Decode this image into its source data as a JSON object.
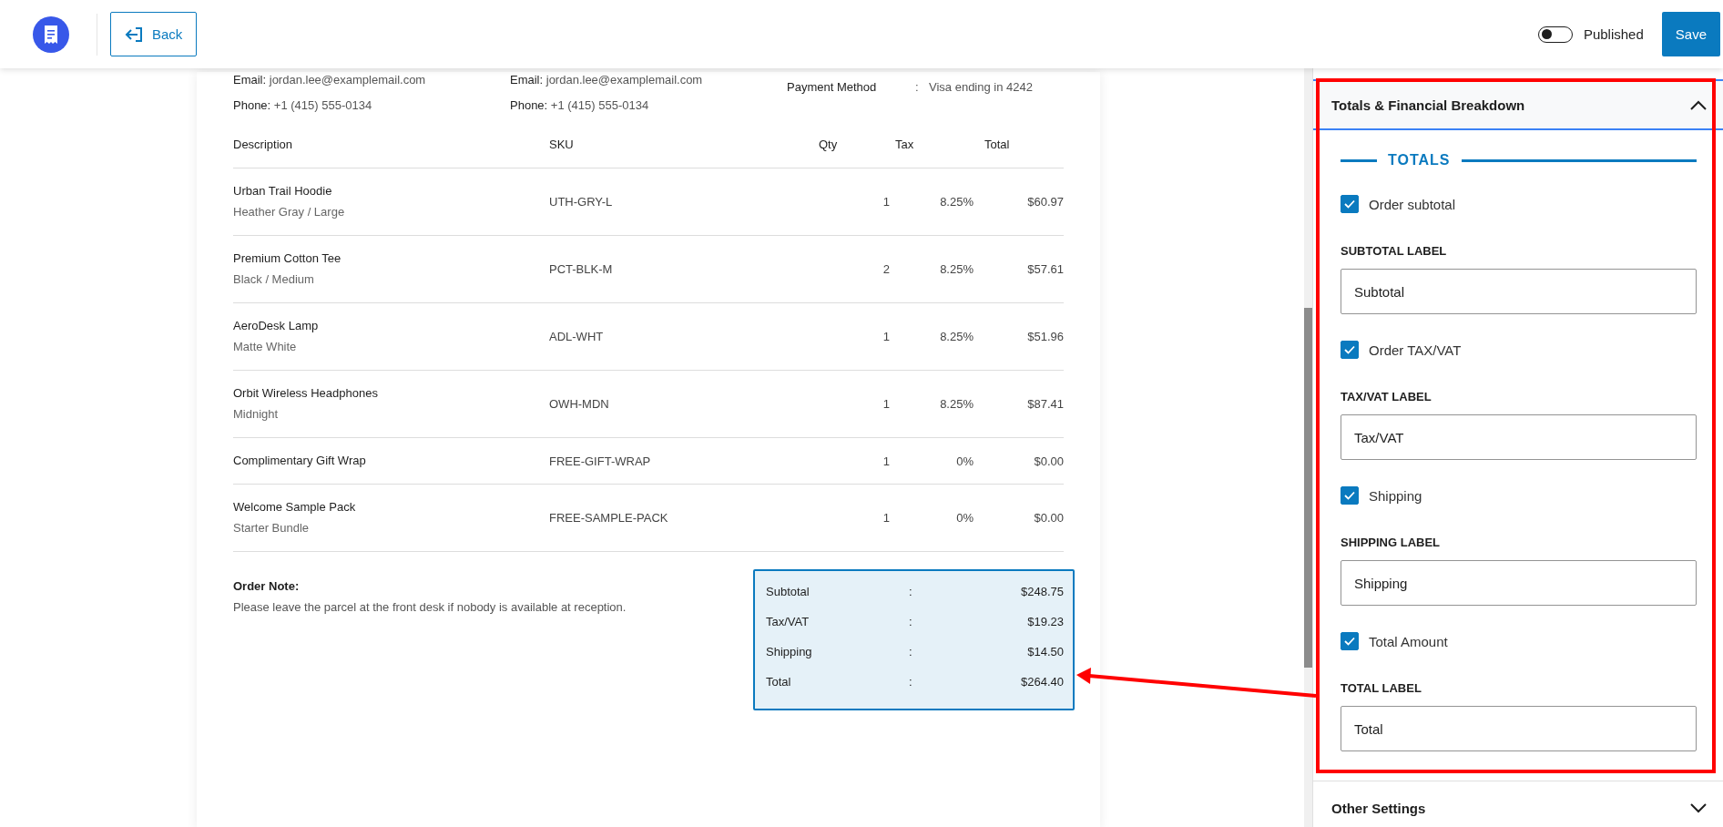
{
  "header": {
    "back_button": "Back",
    "publish_toggle": {
      "label": "Published",
      "on": false
    },
    "save_button": "Save"
  },
  "document": {
    "contacts": [
      {
        "email_label": "Email:",
        "email": "jordan.lee@examplemail.com",
        "phone_label": "Phone:",
        "phone": "+1 (415) 555-0134"
      },
      {
        "email_label": "Email:",
        "email": "jordan.lee@examplemail.com",
        "phone_label": "Phone:",
        "phone": "+1 (415) 555-0134"
      }
    ],
    "payment": {
      "label": "Payment Method",
      "separator": ":",
      "value": "Visa ending in 4242"
    },
    "table": {
      "columns": [
        "Description",
        "SKU",
        "Qty",
        "Tax",
        "Total"
      ],
      "rows": [
        {
          "name": "Urban Trail Hoodie",
          "variant": "Heather Gray / Large",
          "sku": "UTH-GRY-L",
          "qty": "1",
          "tax": "8.25%",
          "total": "$60.97"
        },
        {
          "name": "Premium Cotton Tee",
          "variant": "Black / Medium",
          "sku": "PCT-BLK-M",
          "qty": "2",
          "tax": "8.25%",
          "total": "$57.61"
        },
        {
          "name": "AeroDesk Lamp",
          "variant": "Matte White",
          "sku": "ADL-WHT",
          "qty": "1",
          "tax": "8.25%",
          "total": "$51.96"
        },
        {
          "name": "Orbit Wireless Headphones",
          "variant": "Midnight",
          "sku": "OWH-MDN",
          "qty": "1",
          "tax": "8.25%",
          "total": "$87.41"
        },
        {
          "name": "Complimentary Gift Wrap",
          "sku": "FREE-GIFT-WRAP",
          "qty": "1",
          "tax": "0%",
          "total": "$0.00"
        },
        {
          "name": "Welcome Sample Pack",
          "variant": "Starter Bundle",
          "sku": "FREE-SAMPLE-PACK",
          "qty": "1",
          "tax": "0%",
          "total": "$0.00"
        }
      ]
    },
    "order_note": {
      "title": "Order Note:",
      "text": "Please leave the parcel at the front desk if nobody is available at reception."
    },
    "totals": [
      {
        "label": "Subtotal",
        "separator": ":",
        "value": "$248.75"
      },
      {
        "label": "Tax/VAT",
        "separator": ":",
        "value": "$19.23"
      },
      {
        "label": "Shipping",
        "separator": ":",
        "value": "$14.50"
      },
      {
        "label": "Total",
        "separator": ":",
        "value": "$264.40"
      }
    ]
  },
  "panel": {
    "sections": [
      {
        "title": "Totals & Financial Breakdown",
        "expanded": true,
        "heading": "TOTALS",
        "options": [
          {
            "label": "Order subtotal",
            "checked": true,
            "field_label": "SUBTOTAL LABEL",
            "value": "Subtotal"
          },
          {
            "label": "Order TAX/VAT",
            "checked": true,
            "field_label": "TAX/VAT LABEL",
            "value": "Tax/VAT"
          },
          {
            "label": "Shipping",
            "checked": true,
            "field_label": "SHIPPING LABEL",
            "value": "Shipping"
          },
          {
            "label": "Total Amount",
            "checked": true,
            "field_label": "TOTAL LABEL",
            "value": "Total"
          }
        ]
      },
      {
        "title": "Other Settings",
        "expanded": false
      }
    ]
  }
}
